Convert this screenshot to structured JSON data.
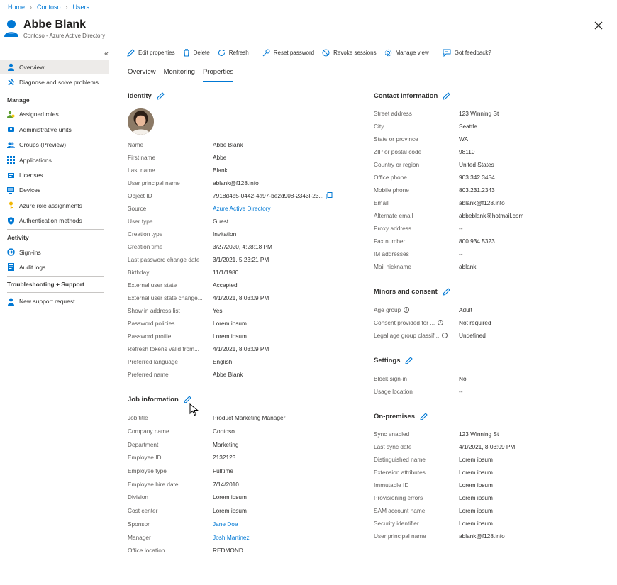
{
  "breadcrumb": [
    "Home",
    "Contoso",
    "Users"
  ],
  "header": {
    "title": "Abbe Blank",
    "subtitle": "Contoso - Azure Active Directory"
  },
  "sidebar": {
    "collapse_glyph": "«",
    "top_items": [
      {
        "label": "Overview",
        "icon": "person-icon"
      },
      {
        "label": "Diagnose and solve problems",
        "icon": "wrench-icon"
      }
    ],
    "manage_title": "Manage",
    "manage_items": [
      {
        "label": "Assigned roles",
        "icon": "roles-icon"
      },
      {
        "label": "Administrative units",
        "icon": "admin-units-icon"
      },
      {
        "label": "Groups (Preview)",
        "icon": "groups-icon"
      },
      {
        "label": "Applications",
        "icon": "apps-grid-icon"
      },
      {
        "label": "Licenses",
        "icon": "license-icon"
      },
      {
        "label": "Devices",
        "icon": "device-icon"
      },
      {
        "label": "Azure role assignments",
        "icon": "key-icon"
      },
      {
        "label": "Authentication methods",
        "icon": "shield-icon"
      }
    ],
    "activity_title": "Activity",
    "activity_items": [
      {
        "label": "Sign-ins",
        "icon": "signin-icon"
      },
      {
        "label": "Audit logs",
        "icon": "log-icon"
      }
    ],
    "trouble_title": "Troubleshooting + Support",
    "trouble_items": [
      {
        "label": "New support request",
        "icon": "support-icon"
      }
    ]
  },
  "toolbar": {
    "edit": "Edit properties",
    "delete": "Delete",
    "refresh": "Refresh",
    "reset_password": "Reset password",
    "revoke": "Revoke sessions",
    "manage_view": "Manage view",
    "feedback": "Got feedback?"
  },
  "tabs": [
    "Overview",
    "Monitoring",
    "Properties"
  ],
  "identity": {
    "title": "Identity",
    "rows": [
      {
        "label": "Name",
        "value": "Abbe Blank"
      },
      {
        "label": "First name",
        "value": "Abbe"
      },
      {
        "label": "Last name",
        "value": "Blank"
      },
      {
        "label": "User principal name",
        "value": "ablank@f128.info"
      },
      {
        "label": "Object ID",
        "value": "7918d4b5-0442-4a97-be2d908-2343l-23..."
      },
      {
        "label": "Source",
        "value": "Azure Active Directory",
        "link": true
      },
      {
        "label": "User type",
        "value": "Guest"
      },
      {
        "label": "Creation type",
        "value": "Invitation"
      },
      {
        "label": "Creation time",
        "value": "3/27/2020, 4:28:18 PM"
      },
      {
        "label": "Last password change date",
        "value": "3/1/2021, 5:23:21 PM"
      },
      {
        "label": "Birthday",
        "value": "11/1/1980"
      },
      {
        "label": "External user state",
        "value": "Accepted"
      },
      {
        "label": "External user state change...",
        "value": "4/1/2021, 8:03:09 PM"
      },
      {
        "label": "Show in address list",
        "value": "Yes"
      },
      {
        "label": "Password policies",
        "value": "Lorem ipsum"
      },
      {
        "label": "Password profile",
        "value": "Lorem ipsum"
      },
      {
        "label": "Refresh tokens valid from...",
        "value": "4/1/2021, 8:03:09 PM"
      },
      {
        "label": "Preferred language",
        "value": "English"
      },
      {
        "label": "Preferred name",
        "value": "Abbe Blank"
      }
    ]
  },
  "job": {
    "title": "Job information",
    "rows": [
      {
        "label": "Job title",
        "value": "Product Marketing Manager"
      },
      {
        "label": "Company name",
        "value": "Contoso"
      },
      {
        "label": "Department",
        "value": "Marketing"
      },
      {
        "label": "Employee ID",
        "value": "2132123"
      },
      {
        "label": "Employee type",
        "value": "Fulltime"
      },
      {
        "label": "Employee hire date",
        "value": "7/14/2010"
      },
      {
        "label": "Division",
        "value": "Lorem ipsum"
      },
      {
        "label": "Cost center",
        "value": "Lorem ipsum"
      },
      {
        "label": "Sponsor",
        "value": "Jane Doe",
        "link": true
      },
      {
        "label": "Manager",
        "value": "Josh Martinez",
        "link": true
      },
      {
        "label": "Office location",
        "value": "REDMOND"
      }
    ]
  },
  "contact": {
    "title": "Contact information",
    "rows": [
      {
        "label": "Street address",
        "value": "123 Winning St"
      },
      {
        "label": "City",
        "value": "Seattle"
      },
      {
        "label": "State or province",
        "value": "WA"
      },
      {
        "label": "ZIP or postal code",
        "value": "98110"
      },
      {
        "label": "Country or region",
        "value": "United States"
      },
      {
        "label": "Office phone",
        "value": "903.342.3454"
      },
      {
        "label": "Mobile phone",
        "value": "803.231.2343"
      },
      {
        "label": "Email",
        "value": "ablank@f128.info"
      },
      {
        "label": "Alternate email",
        "value": "abbeblank@hotmail.com"
      },
      {
        "label": "Proxy address",
        "value": "--"
      },
      {
        "label": "Fax number",
        "value": "800.934.5323"
      },
      {
        "label": "IM addresses",
        "value": "--"
      },
      {
        "label": "Mail nickname",
        "value": "ablank"
      }
    ]
  },
  "minors": {
    "title": "Minors and consent",
    "rows": [
      {
        "label": "Age group",
        "value": "Adult",
        "info": true
      },
      {
        "label": "Consent provided for ...",
        "value": "Not required",
        "info": true
      },
      {
        "label": "Legal age group classif...",
        "value": "Undefined",
        "info": true
      }
    ]
  },
  "settings": {
    "title": "Settings",
    "rows": [
      {
        "label": "Block sign-in",
        "value": "No"
      },
      {
        "label": "Usage location",
        "value": "--"
      }
    ]
  },
  "onprem": {
    "title": "On-premises",
    "rows": [
      {
        "label": "Sync enabled",
        "value": "123 Winning St"
      },
      {
        "label": "Last sync date",
        "value": "4/1/2021, 8:03:09 PM"
      },
      {
        "label": "Distinguished name",
        "value": "Lorem ipsum"
      },
      {
        "label": "Extension attributes",
        "value": "Lorem ipsum"
      },
      {
        "label": "Immutable ID",
        "value": "Lorem ipsum"
      },
      {
        "label": "Provisioning errors",
        "value": "Lorem ipsum"
      },
      {
        "label": "SAM account name",
        "value": "Lorem ipsum"
      },
      {
        "label": "Security identifier",
        "value": "Lorem ipsum"
      },
      {
        "label": "User principal name",
        "value": "ablank@f128.info"
      }
    ]
  },
  "colors": {
    "accent": "#0078d4",
    "link": "#0078d4",
    "text": "#323130",
    "label": "#605e5c"
  }
}
